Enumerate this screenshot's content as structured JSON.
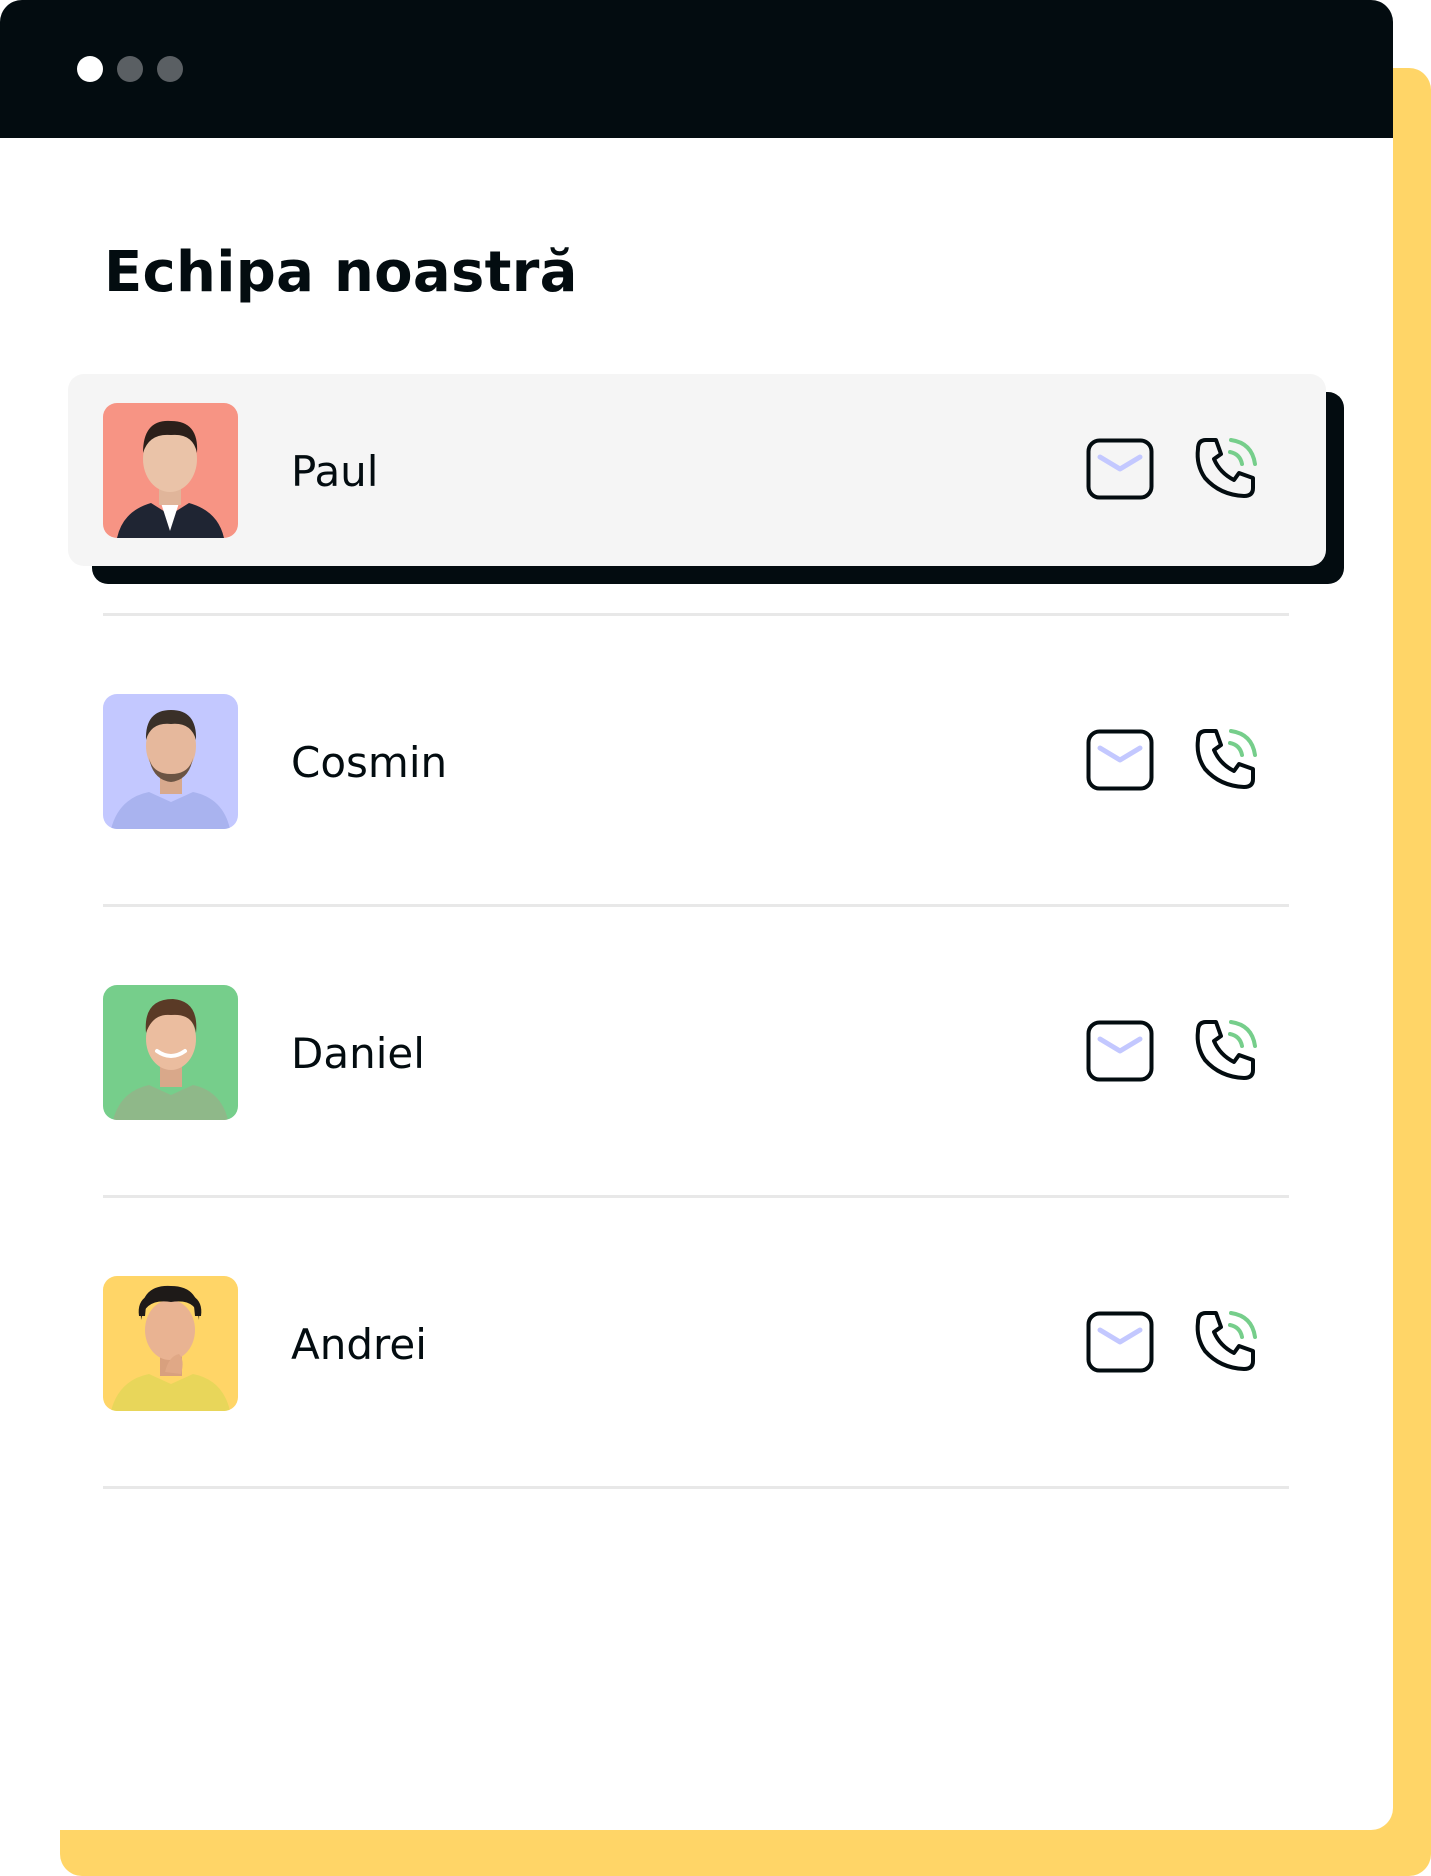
{
  "window": {
    "accent_color": "#FFD567",
    "titlebar_color": "#030C10",
    "controls": [
      "close-dot",
      "minimize-dot",
      "maximize-dot"
    ]
  },
  "page": {
    "title": "Echipa noastră"
  },
  "members": [
    {
      "name": "Paul",
      "avatar_bg": "#F79484",
      "highlighted": true
    },
    {
      "name": "Cosmin",
      "avatar_bg": "#C3C8FF",
      "highlighted": false
    },
    {
      "name": "Daniel",
      "avatar_bg": "#76CE8B",
      "highlighted": false
    },
    {
      "name": "Andrei",
      "avatar_bg": "#FFD567",
      "highlighted": false
    }
  ],
  "icons": {
    "mail": "mail-icon",
    "phone": "phone-icon"
  }
}
